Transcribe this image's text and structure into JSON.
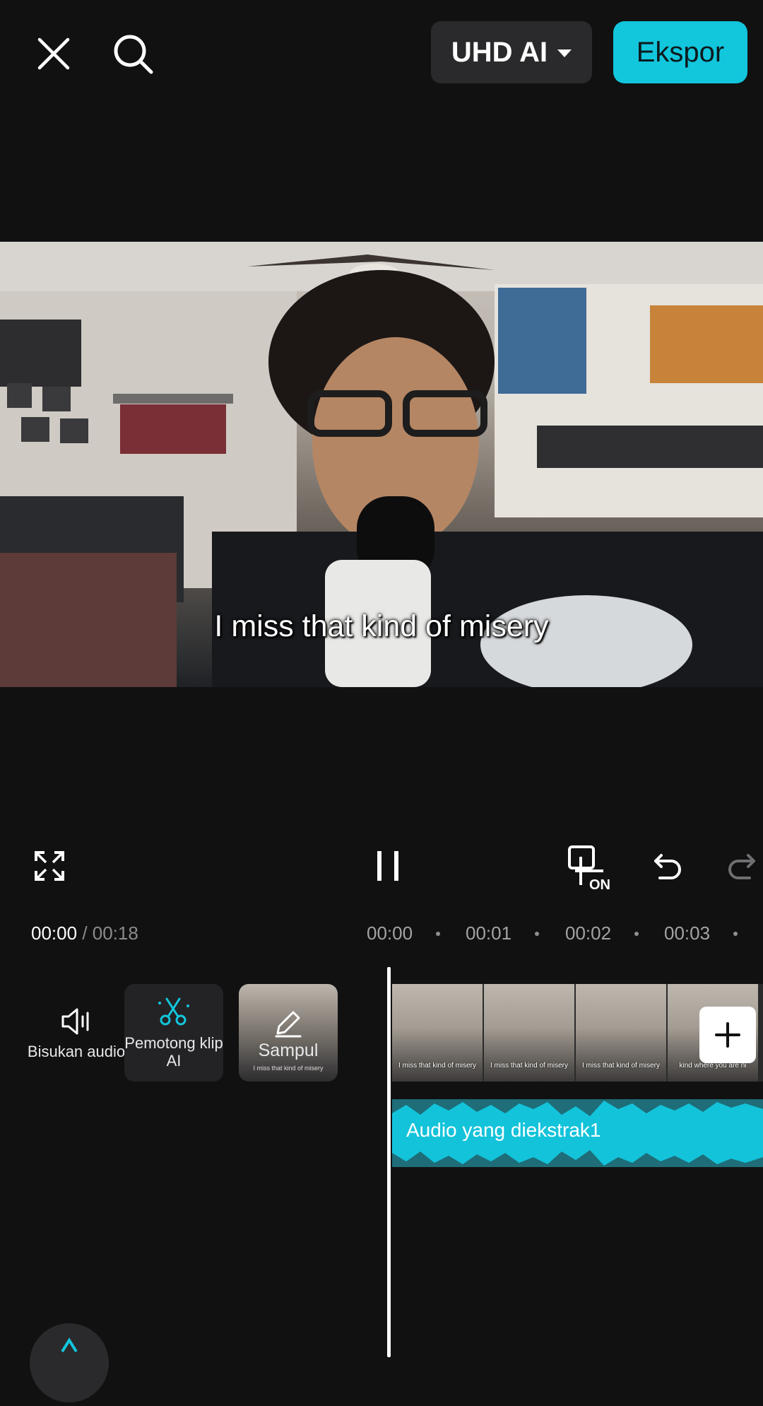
{
  "topbar": {
    "quality_label": "UHD AI",
    "export_label": "Ekspor"
  },
  "preview": {
    "subtitle": "I miss that kind of misery"
  },
  "controls": {
    "current_time": "00:00",
    "total_time": "/ 00:18",
    "ruler": [
      "00:00",
      "00:01",
      "00:02",
      "00:03"
    ]
  },
  "tools": [
    {
      "label": "Bisukan audio",
      "icon": "speaker-icon"
    },
    {
      "label": "Pemotong klip AI",
      "icon": "ai-scissors-icon"
    },
    {
      "label": "Sampul",
      "icon": "pencil-icon"
    }
  ],
  "timeline": {
    "frame_captions": [
      "I miss that kind of misery",
      "I miss that kind of misery",
      "I miss that kind of misery",
      "kind where you are ni"
    ],
    "cover_caption": "I miss that kind of misery",
    "audio_label": "Audio yang diekstrak1"
  },
  "colors": {
    "accent": "#12c6dc",
    "background": "#111112",
    "audio_track": "#1e6d78"
  }
}
